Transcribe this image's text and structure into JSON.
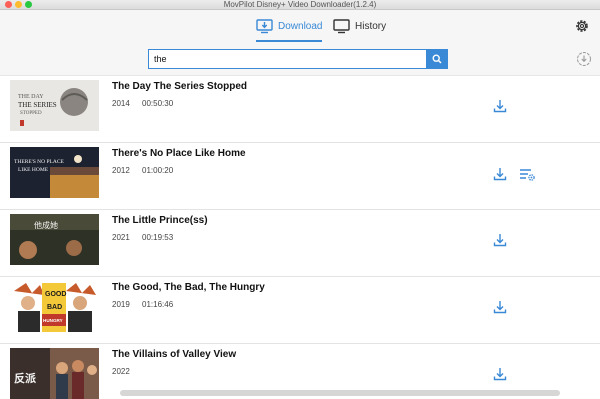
{
  "window": {
    "title": "MovPilot Disney+ Video Downloader(1.2.4)"
  },
  "tabs": {
    "download_label": "Download",
    "history_label": "History"
  },
  "search": {
    "query": "the",
    "placeholder": ""
  },
  "results": [
    {
      "title": "The Day The Series Stopped",
      "year": "2014",
      "duration": "00:50:30"
    },
    {
      "title": "There's No Place Like Home",
      "year": "2012",
      "duration": "01:00:20"
    },
    {
      "title": "The Little Prince(ss)",
      "year": "2021",
      "duration": "00:19:53"
    },
    {
      "title": "The Good, The Bad, The Hungry",
      "year": "2019",
      "duration": "01:16:46"
    },
    {
      "title": "The Villains of Valley View",
      "year": "2022",
      "duration": ""
    }
  ],
  "thumbnails": {
    "t1_text": "THE SERIES",
    "t1_sub": "STOPPED",
    "t2_text": "THERE'S NO PLACE",
    "t2_text2": "LIKE HOME",
    "t3_text": "他成她",
    "t4_text": "GOOD",
    "t4_text2": "BAD",
    "t4_text3": "HUNGRY",
    "t5_text": "反派"
  },
  "colors": {
    "accent": "#3a89d6",
    "title_text": "#111111",
    "meta_text": "#444444"
  },
  "icons": [
    "download-tab-icon",
    "monitor-icon",
    "gear-icon",
    "search-icon",
    "refresh-download-icon",
    "download-icon",
    "settings-list-icon"
  ]
}
